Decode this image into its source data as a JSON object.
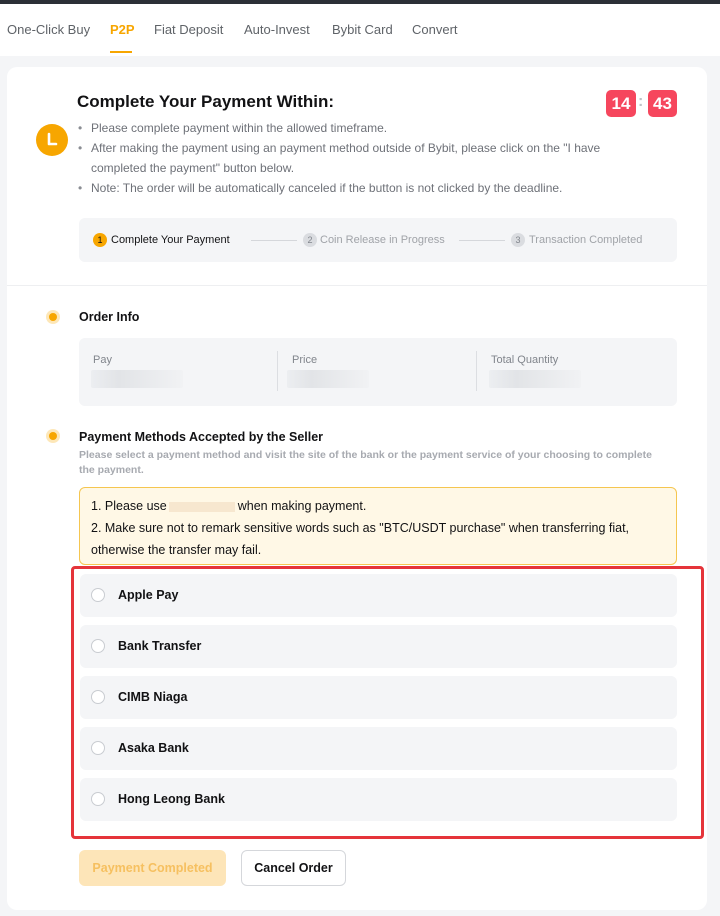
{
  "nav": {
    "items": [
      {
        "label": "One-Click Buy",
        "active": false
      },
      {
        "label": "P2P",
        "active": true
      },
      {
        "label": "Fiat Deposit",
        "active": false
      },
      {
        "label": "Auto-Invest",
        "active": false
      },
      {
        "label": "Bybit Card",
        "active": false
      },
      {
        "label": "Convert",
        "active": false
      }
    ]
  },
  "header": {
    "icon": "clock-icon",
    "title": "Complete Your Payment Within:",
    "timer": {
      "minutes": "14",
      "separator": ":",
      "seconds": "43"
    },
    "bullets": [
      "Please complete payment within the allowed timeframe.",
      "After making the payment using an payment method outside of Bybit, please click on the \"I have completed the payment\" button below.",
      "Note: The order will be automatically canceled if the button is not clicked by the deadline."
    ]
  },
  "steps": [
    {
      "num": "1",
      "label": "Complete Your Payment",
      "active": true
    },
    {
      "num": "2",
      "label": "Coin Release in Progress",
      "active": false
    },
    {
      "num": "3",
      "label": "Transaction Completed",
      "active": false
    }
  ],
  "order_info": {
    "title": "Order Info",
    "fields": [
      {
        "label": "Pay"
      },
      {
        "label": "Price"
      },
      {
        "label": "Total Quantity"
      }
    ]
  },
  "payment_methods": {
    "title": "Payment Methods Accepted by the Seller",
    "description": "Please select a payment method and visit the site of the bank or the payment service of your choosing to complete the payment.",
    "notice": {
      "line1_prefix": "1. Please use",
      "line1_suffix": "when making payment.",
      "line2": "2. Make sure not to remark sensitive words such as \"BTC/USDT purchase\" when transferring fiat, otherwise the transfer may fail."
    },
    "options": [
      {
        "label": "Apple Pay"
      },
      {
        "label": "Bank Transfer"
      },
      {
        "label": "CIMB Niaga"
      },
      {
        "label": "Asaka Bank"
      },
      {
        "label": "Hong Leong Bank"
      }
    ]
  },
  "actions": {
    "payment_completed": "Payment Completed",
    "cancel_order": "Cancel Order"
  },
  "colors": {
    "accent": "#f7a600",
    "timer_red": "#f6465d",
    "highlight_red": "#e5343a"
  }
}
